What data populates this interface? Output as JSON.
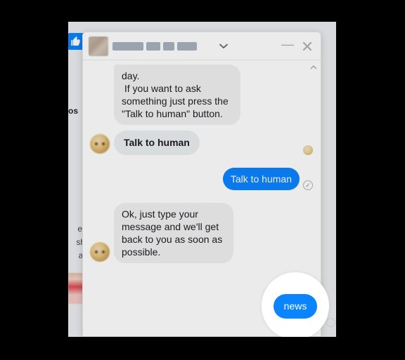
{
  "colors": {
    "accent": "#0a84ff",
    "bubble_in": "#f1f0f0",
    "bubble_out": "#0a84ff"
  },
  "behind": {
    "os_fragment": "os",
    "side_lines": "er\nsh\nal"
  },
  "header": {
    "avatar": "bot-avatar",
    "title_redacted": true,
    "chevron_aria": "expand-conversation",
    "minimize_aria": "Minimize",
    "close_aria": "Close"
  },
  "messages": [
    {
      "side": "in",
      "type": "text",
      "text": "day.\n If you want to ask something just press the \"Talk to human\" button.",
      "show_avatar": false
    },
    {
      "side": "in",
      "type": "quickreply",
      "text": "Talk to human",
      "show_avatar": true,
      "status": "seen"
    },
    {
      "side": "out",
      "type": "text",
      "text": "Talk to human",
      "status": "delivered"
    },
    {
      "side": "in",
      "type": "text",
      "text": "Ok, just type your message and we'll get back to you as soon as possible.",
      "show_avatar": true
    }
  ],
  "highlight": {
    "label": "news"
  }
}
